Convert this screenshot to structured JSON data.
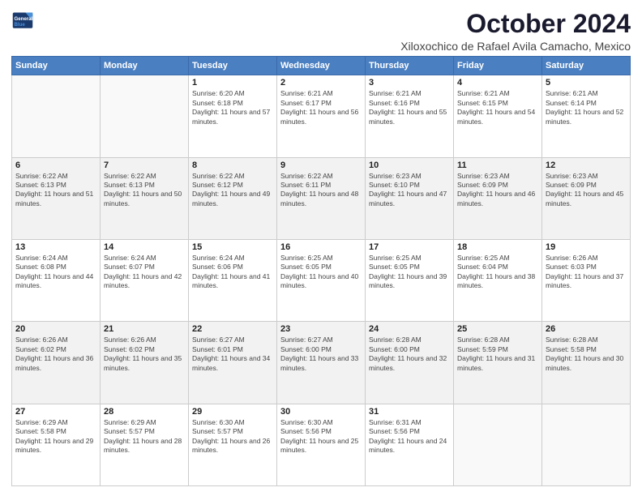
{
  "logo": {
    "line1": "General",
    "line2": "Blue"
  },
  "title": "October 2024",
  "location": "Xiloxochico de Rafael Avila Camacho, Mexico",
  "days_of_week": [
    "Sunday",
    "Monday",
    "Tuesday",
    "Wednesday",
    "Thursday",
    "Friday",
    "Saturday"
  ],
  "weeks": [
    [
      {
        "num": "",
        "sunrise": "",
        "sunset": "",
        "daylight": ""
      },
      {
        "num": "",
        "sunrise": "",
        "sunset": "",
        "daylight": ""
      },
      {
        "num": "1",
        "sunrise": "6:20 AM",
        "sunset": "6:18 PM",
        "daylight": "11 hours and 57 minutes."
      },
      {
        "num": "2",
        "sunrise": "6:21 AM",
        "sunset": "6:17 PM",
        "daylight": "11 hours and 56 minutes."
      },
      {
        "num": "3",
        "sunrise": "6:21 AM",
        "sunset": "6:16 PM",
        "daylight": "11 hours and 55 minutes."
      },
      {
        "num": "4",
        "sunrise": "6:21 AM",
        "sunset": "6:15 PM",
        "daylight": "11 hours and 54 minutes."
      },
      {
        "num": "5",
        "sunrise": "6:21 AM",
        "sunset": "6:14 PM",
        "daylight": "11 hours and 52 minutes."
      }
    ],
    [
      {
        "num": "6",
        "sunrise": "6:22 AM",
        "sunset": "6:13 PM",
        "daylight": "11 hours and 51 minutes."
      },
      {
        "num": "7",
        "sunrise": "6:22 AM",
        "sunset": "6:13 PM",
        "daylight": "11 hours and 50 minutes."
      },
      {
        "num": "8",
        "sunrise": "6:22 AM",
        "sunset": "6:12 PM",
        "daylight": "11 hours and 49 minutes."
      },
      {
        "num": "9",
        "sunrise": "6:22 AM",
        "sunset": "6:11 PM",
        "daylight": "11 hours and 48 minutes."
      },
      {
        "num": "10",
        "sunrise": "6:23 AM",
        "sunset": "6:10 PM",
        "daylight": "11 hours and 47 minutes."
      },
      {
        "num": "11",
        "sunrise": "6:23 AM",
        "sunset": "6:09 PM",
        "daylight": "11 hours and 46 minutes."
      },
      {
        "num": "12",
        "sunrise": "6:23 AM",
        "sunset": "6:09 PM",
        "daylight": "11 hours and 45 minutes."
      }
    ],
    [
      {
        "num": "13",
        "sunrise": "6:24 AM",
        "sunset": "6:08 PM",
        "daylight": "11 hours and 44 minutes."
      },
      {
        "num": "14",
        "sunrise": "6:24 AM",
        "sunset": "6:07 PM",
        "daylight": "11 hours and 42 minutes."
      },
      {
        "num": "15",
        "sunrise": "6:24 AM",
        "sunset": "6:06 PM",
        "daylight": "11 hours and 41 minutes."
      },
      {
        "num": "16",
        "sunrise": "6:25 AM",
        "sunset": "6:05 PM",
        "daylight": "11 hours and 40 minutes."
      },
      {
        "num": "17",
        "sunrise": "6:25 AM",
        "sunset": "6:05 PM",
        "daylight": "11 hours and 39 minutes."
      },
      {
        "num": "18",
        "sunrise": "6:25 AM",
        "sunset": "6:04 PM",
        "daylight": "11 hours and 38 minutes."
      },
      {
        "num": "19",
        "sunrise": "6:26 AM",
        "sunset": "6:03 PM",
        "daylight": "11 hours and 37 minutes."
      }
    ],
    [
      {
        "num": "20",
        "sunrise": "6:26 AM",
        "sunset": "6:02 PM",
        "daylight": "11 hours and 36 minutes."
      },
      {
        "num": "21",
        "sunrise": "6:26 AM",
        "sunset": "6:02 PM",
        "daylight": "11 hours and 35 minutes."
      },
      {
        "num": "22",
        "sunrise": "6:27 AM",
        "sunset": "6:01 PM",
        "daylight": "11 hours and 34 minutes."
      },
      {
        "num": "23",
        "sunrise": "6:27 AM",
        "sunset": "6:00 PM",
        "daylight": "11 hours and 33 minutes."
      },
      {
        "num": "24",
        "sunrise": "6:28 AM",
        "sunset": "6:00 PM",
        "daylight": "11 hours and 32 minutes."
      },
      {
        "num": "25",
        "sunrise": "6:28 AM",
        "sunset": "5:59 PM",
        "daylight": "11 hours and 31 minutes."
      },
      {
        "num": "26",
        "sunrise": "6:28 AM",
        "sunset": "5:58 PM",
        "daylight": "11 hours and 30 minutes."
      }
    ],
    [
      {
        "num": "27",
        "sunrise": "6:29 AM",
        "sunset": "5:58 PM",
        "daylight": "11 hours and 29 minutes."
      },
      {
        "num": "28",
        "sunrise": "6:29 AM",
        "sunset": "5:57 PM",
        "daylight": "11 hours and 28 minutes."
      },
      {
        "num": "29",
        "sunrise": "6:30 AM",
        "sunset": "5:57 PM",
        "daylight": "11 hours and 26 minutes."
      },
      {
        "num": "30",
        "sunrise": "6:30 AM",
        "sunset": "5:56 PM",
        "daylight": "11 hours and 25 minutes."
      },
      {
        "num": "31",
        "sunrise": "6:31 AM",
        "sunset": "5:56 PM",
        "daylight": "11 hours and 24 minutes."
      },
      {
        "num": "",
        "sunrise": "",
        "sunset": "",
        "daylight": ""
      },
      {
        "num": "",
        "sunrise": "",
        "sunset": "",
        "daylight": ""
      }
    ]
  ],
  "labels": {
    "sunrise_prefix": "Sunrise: ",
    "sunset_prefix": "Sunset: ",
    "daylight_prefix": "Daylight: "
  }
}
